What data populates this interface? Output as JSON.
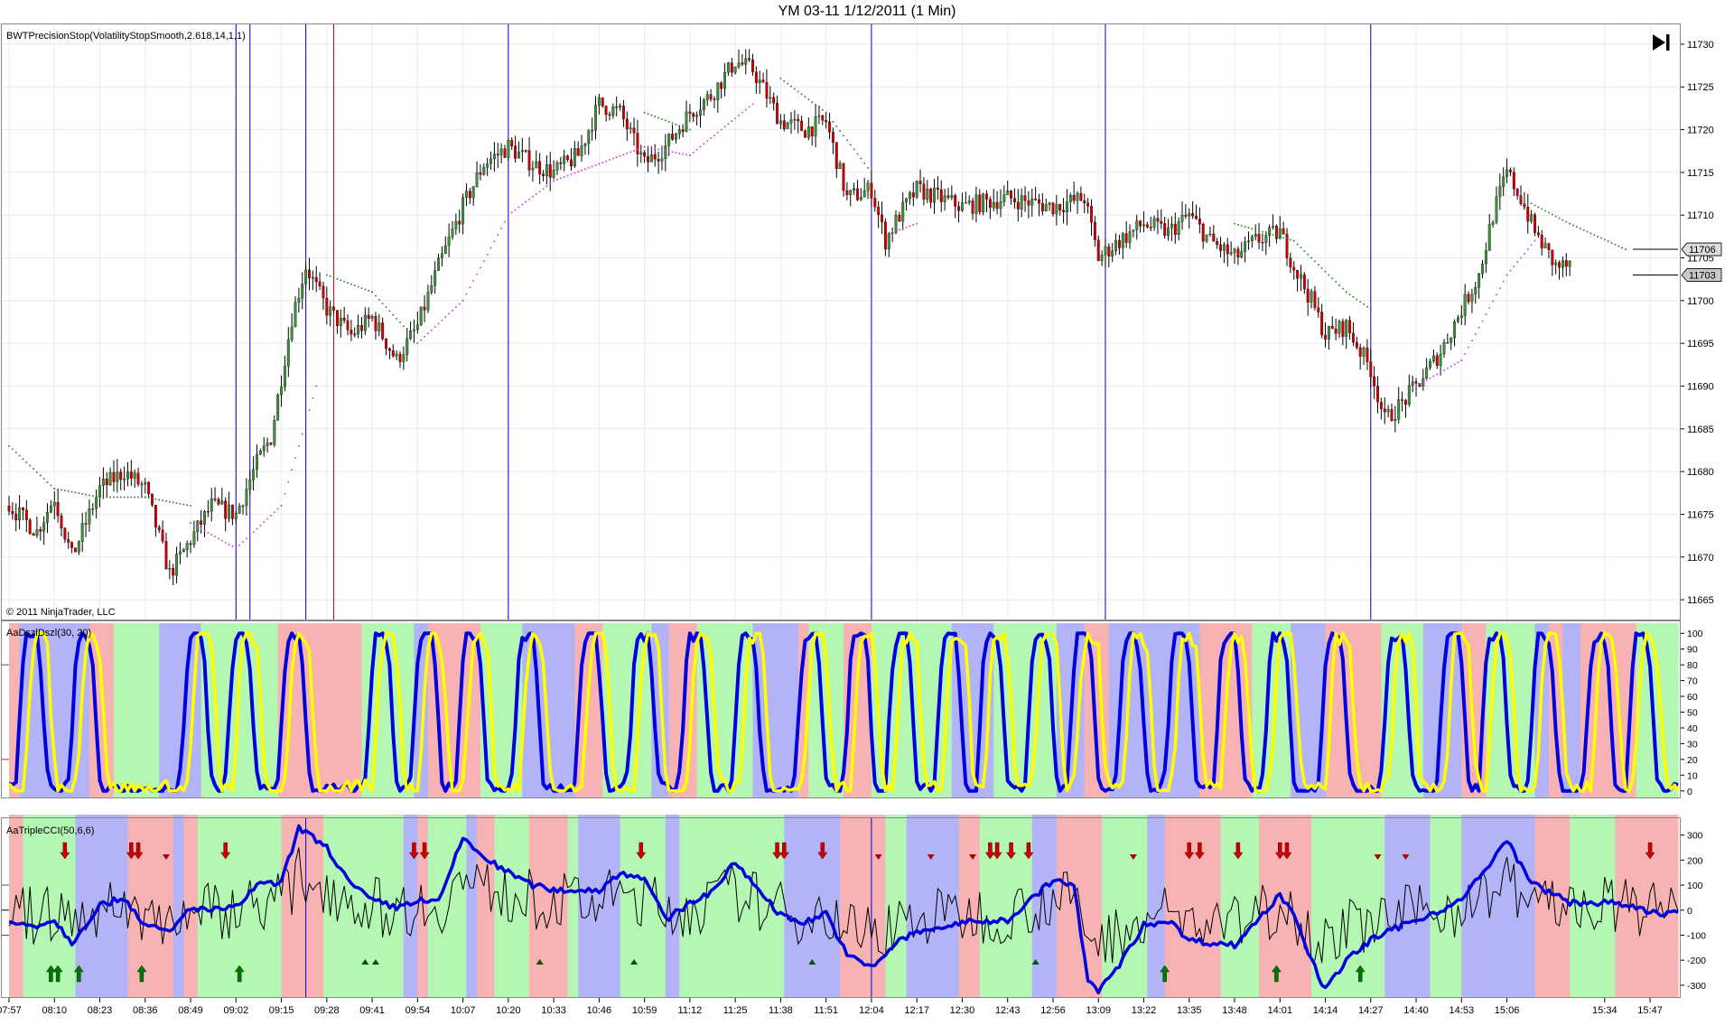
{
  "window": {
    "title": "YM 03-11  1/12/2011 (1 Min)"
  },
  "copyright": "© 2011 NinjaTrader, LLC",
  "icons": {
    "go_to_end": "skip-to-end-icon"
  },
  "colors": {
    "up_candle": "#3e8e3e",
    "down_candle": "#cc0000",
    "wick": "#000000",
    "stop_long": "#cc33cc",
    "stop_short": "#227722",
    "dsz_fast": "#ffff00",
    "dsz_slow": "#0000dd",
    "cci_fast": "#000000",
    "cci_slow": "#0000dd",
    "zone_red": "#f7b3b3",
    "zone_green": "#b3f7b3",
    "zone_blue": "#b3b3f7",
    "vline_blue": "#0000cc",
    "vline_red": "#cc0000",
    "arrow_up": "#007700",
    "arrow_down": "#cc0000"
  },
  "chart_data": [
    {
      "type": "candlestick",
      "panel": "price",
      "indicator_label": "BWTPrecisionStop(VolatilityStopSmooth,2.618,14,1,1)",
      "ylim": [
        11663,
        11732
      ],
      "y_ticks": [
        11730,
        11725,
        11720,
        11715,
        11710,
        11705,
        11700,
        11695,
        11690,
        11685,
        11680,
        11675,
        11670,
        11665
      ],
      "last_price_labels": [
        11706,
        11703
      ],
      "x_time_ticks": [
        "07:57",
        "08:10",
        "08:23",
        "08:36",
        "08:49",
        "09:02",
        "09:15",
        "09:28",
        "09:41",
        "09:54",
        "10:07",
        "10:20",
        "10:33",
        "10:46",
        "10:59",
        "11:12",
        "11:25",
        "11:38",
        "11:51",
        "12:04",
        "12:17",
        "12:30",
        "12:43",
        "12:56",
        "13:09",
        "13:22",
        "13:35",
        "13:48",
        "14:01",
        "14:14",
        "14:27",
        "14:40",
        "14:53",
        "15:06",
        "15:34",
        "15:47"
      ],
      "close_path": [
        {
          "t": "07:57",
          "y": 11676
        },
        {
          "t": "08:05",
          "y": 11673
        },
        {
          "t": "08:10",
          "y": 11677
        },
        {
          "t": "08:15",
          "y": 11670
        },
        {
          "t": "08:23",
          "y": 11678
        },
        {
          "t": "08:30",
          "y": 11680
        },
        {
          "t": "08:36",
          "y": 11678
        },
        {
          "t": "08:43",
          "y": 11668
        },
        {
          "t": "08:49",
          "y": 11672
        },
        {
          "t": "08:55",
          "y": 11676
        },
        {
          "t": "09:02",
          "y": 11675
        },
        {
          "t": "09:08",
          "y": 11681
        },
        {
          "t": "09:12",
          "y": 11684
        },
        {
          "t": "09:18",
          "y": 11698
        },
        {
          "t": "09:22",
          "y": 11704
        },
        {
          "t": "09:28",
          "y": 11699
        },
        {
          "t": "09:35",
          "y": 11696
        },
        {
          "t": "09:41",
          "y": 11698
        },
        {
          "t": "09:48",
          "y": 11693
        },
        {
          "t": "09:54",
          "y": 11697
        },
        {
          "t": "10:00",
          "y": 11704
        },
        {
          "t": "10:07",
          "y": 11711
        },
        {
          "t": "10:13",
          "y": 11716
        },
        {
          "t": "10:20",
          "y": 11718
        },
        {
          "t": "10:27",
          "y": 11716
        },
        {
          "t": "10:33",
          "y": 11715
        },
        {
          "t": "10:40",
          "y": 11717
        },
        {
          "t": "10:46",
          "y": 11723
        },
        {
          "t": "10:52",
          "y": 11722
        },
        {
          "t": "10:59",
          "y": 11716
        },
        {
          "t": "11:05",
          "y": 11718
        },
        {
          "t": "11:12",
          "y": 11722
        },
        {
          "t": "11:18",
          "y": 11724
        },
        {
          "t": "11:25",
          "y": 11728
        },
        {
          "t": "11:30",
          "y": 11727
        },
        {
          "t": "11:38",
          "y": 11721
        },
        {
          "t": "11:45",
          "y": 11720
        },
        {
          "t": "11:51",
          "y": 11721
        },
        {
          "t": "11:57",
          "y": 11712
        },
        {
          "t": "12:04",
          "y": 11713
        },
        {
          "t": "12:08",
          "y": 11707
        },
        {
          "t": "12:12",
          "y": 11710
        },
        {
          "t": "12:17",
          "y": 11713
        },
        {
          "t": "12:30",
          "y": 11711
        },
        {
          "t": "12:43",
          "y": 11712
        },
        {
          "t": "12:56",
          "y": 11711
        },
        {
          "t": "13:05",
          "y": 11712
        },
        {
          "t": "13:09",
          "y": 11705
        },
        {
          "t": "13:15",
          "y": 11707
        },
        {
          "t": "13:22",
          "y": 11709
        },
        {
          "t": "13:29",
          "y": 11708
        },
        {
          "t": "13:35",
          "y": 11710
        },
        {
          "t": "13:41",
          "y": 11707
        },
        {
          "t": "13:48",
          "y": 11705
        },
        {
          "t": "13:54",
          "y": 11707
        },
        {
          "t": "14:01",
          "y": 11708
        },
        {
          "t": "14:05",
          "y": 11704
        },
        {
          "t": "14:10",
          "y": 11700
        },
        {
          "t": "14:14",
          "y": 11696
        },
        {
          "t": "14:20",
          "y": 11697
        },
        {
          "t": "14:27",
          "y": 11692
        },
        {
          "t": "14:31",
          "y": 11686
        },
        {
          "t": "14:36",
          "y": 11688
        },
        {
          "t": "14:40",
          "y": 11690
        },
        {
          "t": "14:47",
          "y": 11694
        },
        {
          "t": "14:53",
          "y": 11699
        },
        {
          "t": "14:58",
          "y": 11703
        },
        {
          "t": "15:02",
          "y": 11710
        },
        {
          "t": "15:06",
          "y": 11715
        },
        {
          "t": "15:10",
          "y": 11712
        },
        {
          "t": "15:14",
          "y": 11708
        },
        {
          "t": "15:20",
          "y": 11704
        },
        {
          "t": "15:24",
          "y": 11704
        }
      ],
      "stop_long": [
        {
          "t": "08:49",
          "y": 11674
        },
        {
          "t": "09:02",
          "y": 11671
        },
        {
          "t": "09:15",
          "y": 11676
        },
        {
          "t": "09:25",
          "y": 11690
        },
        {
          "t": "09:54",
          "y": 11695
        },
        {
          "t": "10:07",
          "y": 11700
        },
        {
          "t": "10:20",
          "y": 11710
        },
        {
          "t": "10:33",
          "y": 11714
        },
        {
          "t": "10:46",
          "y": 11716
        },
        {
          "t": "10:59",
          "y": 11718
        },
        {
          "t": "11:12",
          "y": 11717
        },
        {
          "t": "11:30",
          "y": 11723
        },
        {
          "t": "12:10",
          "y": 11708
        },
        {
          "t": "12:17",
          "y": 11709
        },
        {
          "t": "13:09",
          "y": 11705
        },
        {
          "t": "13:35",
          "y": 11707
        },
        {
          "t": "14:40",
          "y": 11690
        },
        {
          "t": "14:53",
          "y": 11693
        },
        {
          "t": "15:06",
          "y": 11703
        },
        {
          "t": "15:14",
          "y": 11707
        }
      ],
      "stop_short": [
        {
          "t": "07:57",
          "y": 11683
        },
        {
          "t": "08:10",
          "y": 11678
        },
        {
          "t": "08:23",
          "y": 11677
        },
        {
          "t": "08:36",
          "y": 11677
        },
        {
          "t": "08:49",
          "y": 11676
        },
        {
          "t": "09:28",
          "y": 11703
        },
        {
          "t": "09:41",
          "y": 11701
        },
        {
          "t": "09:50",
          "y": 11697
        },
        {
          "t": "10:59",
          "y": 11722
        },
        {
          "t": "11:12",
          "y": 11720
        },
        {
          "t": "11:38",
          "y": 11726
        },
        {
          "t": "11:51",
          "y": 11722
        },
        {
          "t": "12:04",
          "y": 11715
        },
        {
          "t": "12:43",
          "y": 11712
        },
        {
          "t": "13:05",
          "y": 11710
        },
        {
          "t": "13:48",
          "y": 11709
        },
        {
          "t": "14:05",
          "y": 11707
        },
        {
          "t": "14:20",
          "y": 11701
        },
        {
          "t": "14:27",
          "y": 11699
        },
        {
          "t": "15:10",
          "y": 11712
        },
        {
          "t": "15:24",
          "y": 11709
        },
        {
          "t": "15:40",
          "y": 11706
        }
      ],
      "vertical_lines": [
        {
          "t": "09:02",
          "color": "blue"
        },
        {
          "t": "09:06",
          "color": "blue"
        },
        {
          "t": "09:22",
          "color": "blue"
        },
        {
          "t": "09:30",
          "color": "red"
        },
        {
          "t": "10:20",
          "color": "blue"
        },
        {
          "t": "12:04",
          "color": "blue"
        },
        {
          "t": "13:11",
          "color": "blue"
        },
        {
          "t": "14:27",
          "color": "blue"
        }
      ]
    },
    {
      "type": "line",
      "panel": "oscillator",
      "indicator_label": "AaDszlDszl(30, 20)",
      "ylim": [
        -3,
        103
      ],
      "y_ticks": [
        100,
        90,
        80,
        70,
        60,
        50,
        40,
        30,
        20,
        10,
        0
      ],
      "levels": [
        80,
        20
      ],
      "series": [],
      "cycle_highs_times": [
        "08:05",
        "08:20",
        "08:52",
        "09:05",
        "09:20",
        "09:45",
        "09:58",
        "10:11",
        "10:27",
        "10:45",
        "11:00",
        "11:15",
        "11:30",
        "11:48",
        "12:02",
        "12:14",
        "12:28",
        "12:40",
        "12:54",
        "13:06",
        "13:20",
        "13:34",
        "13:48",
        "14:02",
        "14:18",
        "14:36",
        "14:52",
        "15:04",
        "15:18",
        "15:34",
        "15:46"
      ]
    },
    {
      "type": "line",
      "panel": "oscillator",
      "indicator_label": "AaTripleCCI(50,6,6)",
      "ylim": [
        -340,
        360
      ],
      "y_ticks": [
        300,
        200,
        100,
        0,
        -100,
        -200,
        -300
      ],
      "levels": [
        100,
        0,
        -100
      ],
      "series": [],
      "cci_slow_path": [
        {
          "t": "07:57",
          "y": -50
        },
        {
          "t": "08:05",
          "y": -60
        },
        {
          "t": "08:10",
          "y": -40
        },
        {
          "t": "08:15",
          "y": -130
        },
        {
          "t": "08:23",
          "y": 20
        },
        {
          "t": "08:30",
          "y": 50
        },
        {
          "t": "08:36",
          "y": -60
        },
        {
          "t": "08:43",
          "y": -90
        },
        {
          "t": "08:49",
          "y": 10
        },
        {
          "t": "08:55",
          "y": 0
        },
        {
          "t": "09:02",
          "y": 10
        },
        {
          "t": "09:08",
          "y": 100
        },
        {
          "t": "09:15",
          "y": 110
        },
        {
          "t": "09:20",
          "y": 330
        },
        {
          "t": "09:28",
          "y": 250
        },
        {
          "t": "09:35",
          "y": 100
        },
        {
          "t": "09:41",
          "y": 40
        },
        {
          "t": "09:48",
          "y": 10
        },
        {
          "t": "09:54",
          "y": 40
        },
        {
          "t": "10:00",
          "y": 30
        },
        {
          "t": "10:07",
          "y": 290
        },
        {
          "t": "10:13",
          "y": 210
        },
        {
          "t": "10:20",
          "y": 150
        },
        {
          "t": "10:27",
          "y": 100
        },
        {
          "t": "10:33",
          "y": 80
        },
        {
          "t": "10:46",
          "y": 80
        },
        {
          "t": "10:52",
          "y": 150
        },
        {
          "t": "10:59",
          "y": 130
        },
        {
          "t": "11:05",
          "y": -40
        },
        {
          "t": "11:12",
          "y": 30
        },
        {
          "t": "11:18",
          "y": 70
        },
        {
          "t": "11:25",
          "y": 190
        },
        {
          "t": "11:30",
          "y": 110
        },
        {
          "t": "11:38",
          "y": -20
        },
        {
          "t": "11:45",
          "y": -50
        },
        {
          "t": "11:51",
          "y": -10
        },
        {
          "t": "11:57",
          "y": -180
        },
        {
          "t": "12:04",
          "y": -230
        },
        {
          "t": "12:12",
          "y": -120
        },
        {
          "t": "12:17",
          "y": -90
        },
        {
          "t": "12:30",
          "y": -50
        },
        {
          "t": "12:43",
          "y": -40
        },
        {
          "t": "12:56",
          "y": 120
        },
        {
          "t": "13:02",
          "y": 100
        },
        {
          "t": "13:06",
          "y": -290
        },
        {
          "t": "13:09",
          "y": -320
        },
        {
          "t": "13:15",
          "y": -220
        },
        {
          "t": "13:22",
          "y": -60
        },
        {
          "t": "13:29",
          "y": -40
        },
        {
          "t": "13:35",
          "y": -120
        },
        {
          "t": "13:48",
          "y": -140
        },
        {
          "t": "14:01",
          "y": 60
        },
        {
          "t": "14:05",
          "y": -10
        },
        {
          "t": "14:10",
          "y": -200
        },
        {
          "t": "14:14",
          "y": -320
        },
        {
          "t": "14:20",
          "y": -200
        },
        {
          "t": "14:27",
          "y": -120
        },
        {
          "t": "14:36",
          "y": -60
        },
        {
          "t": "14:40",
          "y": -40
        },
        {
          "t": "14:47",
          "y": 0
        },
        {
          "t": "14:53",
          "y": 40
        },
        {
          "t": "15:02",
          "y": 200
        },
        {
          "t": "15:06",
          "y": 280
        },
        {
          "t": "15:10",
          "y": 180
        },
        {
          "t": "15:14",
          "y": 100
        },
        {
          "t": "15:24",
          "y": 30
        },
        {
          "t": "15:34",
          "y": 30
        },
        {
          "t": "15:40",
          "y": 20
        },
        {
          "t": "15:47",
          "y": -10
        }
      ],
      "up_arrow_times": [
        "08:09",
        "08:11",
        "08:17",
        "08:35",
        "09:03",
        "14:24",
        "13:28",
        "14:00"
      ],
      "down_arrow_times": [
        "08:13",
        "08:32",
        "08:34",
        "08:59",
        "09:53",
        "09:56",
        "10:58",
        "11:37",
        "11:39",
        "11:50",
        "12:38",
        "12:40",
        "12:44",
        "12:49",
        "13:35",
        "13:38",
        "13:49",
        "14:01",
        "14:03",
        "15:47"
      ],
      "small_up_marks": [
        "09:39",
        "09:42",
        "10:29",
        "10:56",
        "11:47",
        "12:51"
      ],
      "small_down_marks": [
        "08:42",
        "12:06",
        "12:21",
        "12:33",
        "13:19",
        "14:29",
        "14:37"
      ]
    }
  ]
}
